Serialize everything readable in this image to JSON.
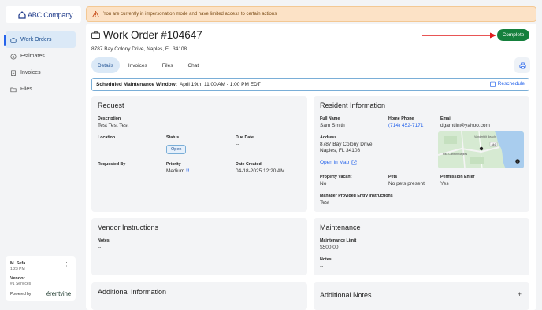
{
  "brand": {
    "logo_text": "ABC Company"
  },
  "sidebar": {
    "items": [
      {
        "label": "Work Orders",
        "icon": "briefcase-icon",
        "active": true
      },
      {
        "label": "Estimates",
        "icon": "dollar-circle-icon",
        "active": false
      },
      {
        "label": "Invoices",
        "icon": "receipt-icon",
        "active": false
      },
      {
        "label": "Files",
        "icon": "folder-icon",
        "active": false
      }
    ],
    "user": {
      "name": "M. Sefa",
      "time": "1:23 PM",
      "vendor_label": "Vendor",
      "vendor_name": "#1 Services",
      "powered_by": "Powered by",
      "powered_brand": "érentvine"
    }
  },
  "alert": {
    "text": "You are currently in impersonation mode and have limited access to certain actions"
  },
  "header": {
    "title": "Work Order #104647",
    "address": "8787 Bay Colony Drive, Naples, FL 34108",
    "complete_label": "Complete"
  },
  "tabs": [
    {
      "label": "Details",
      "active": true
    },
    {
      "label": "Invoices",
      "active": false
    },
    {
      "label": "Files",
      "active": false
    },
    {
      "label": "Chat",
      "active": false
    }
  ],
  "schedule": {
    "label": "Scheduled Maintenance Window:",
    "value": "April 19th, 11:00 AM - 1:00 PM EDT",
    "reschedule_label": "Reschedule"
  },
  "request": {
    "title": "Request",
    "description_label": "Description",
    "description_value": "Test Test Test",
    "location_label": "Location",
    "location_value": "",
    "status_label": "Status",
    "status_value": "Open",
    "due_label": "Due Date",
    "due_value": "--",
    "requested_by_label": "Requested By",
    "requested_by_value": "",
    "priority_label": "Priority",
    "priority_value": "Medium",
    "priority_marker": "!!",
    "created_label": "Date Created",
    "created_value": "04-18-2025 12:20 AM"
  },
  "resident": {
    "title": "Resident Information",
    "name_label": "Full Name",
    "name_value": "Sam Smith",
    "phone_label": "Home Phone",
    "phone_value": "(714) 452-7171",
    "email_label": "Email",
    "email_value": "dgamtiin@yahoo.com",
    "address_label": "Address",
    "address_line1": "8787 Bay Colony Drive",
    "address_line2": "Naples, FL 34108",
    "map_link": "Open in Map",
    "vacant_label": "Property Vacant",
    "vacant_value": "No",
    "pets_label": "Pets",
    "pets_value": "No pets present",
    "permission_label": "Permission Enter",
    "permission_value": "Yes",
    "entry_label": "Manager Provided Entry Instructions",
    "entry_value": "Test",
    "map_labels": {
      "place1": "Vanderbilt Beach",
      "place2": "Ritz-Carlton Naples",
      "road": "846"
    }
  },
  "vendor_instructions": {
    "title": "Vendor Instructions",
    "notes_label": "Notes",
    "notes_value": "--"
  },
  "maintenance": {
    "title": "Maintenance",
    "limit_label": "Maintenance Limit",
    "limit_value": "$500.00",
    "notes_label": "Notes",
    "notes_value": "--"
  },
  "additional_info": {
    "title": "Additional Information"
  },
  "additional_notes": {
    "title": "Additional Notes",
    "add_label": "+"
  }
}
